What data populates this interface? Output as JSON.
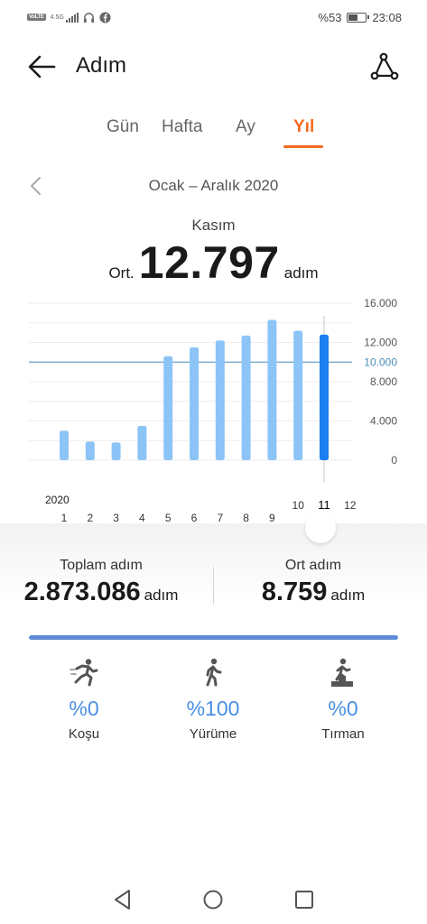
{
  "status_bar": {
    "volte": "VoLTE",
    "network": "4.5G",
    "battery_text": "%53",
    "battery_level": 0.53,
    "time": "23:08",
    "icons": [
      "headset-icon",
      "facebook-icon",
      "signal-icon",
      "battery-icon"
    ]
  },
  "app_bar": {
    "title": "Adım",
    "back_icon": "arrow-left-icon",
    "share_icon": "share-icon"
  },
  "tabs": [
    {
      "label": "Gün",
      "active": false
    },
    {
      "label": "Hafta",
      "active": false
    },
    {
      "label": "Ay",
      "active": false
    },
    {
      "label": "Yıl",
      "active": true
    }
  ],
  "period": {
    "label": "Ocak – Aralık 2020",
    "prev_icon": "chevron-left-icon"
  },
  "summary": {
    "month": "Kasım",
    "prefix": "Ort.",
    "value": "12.797",
    "unit": "adım"
  },
  "chart_data": {
    "type": "bar",
    "x": [
      1,
      2,
      3,
      4,
      5,
      6,
      7,
      8,
      9,
      10,
      11,
      12
    ],
    "tick_labels": [
      "1",
      "2",
      "3",
      "4",
      "5",
      "6",
      "7",
      "8",
      "9",
      "10",
      "11",
      "12"
    ],
    "year_label": "2020",
    "values": [
      3000,
      1900,
      1800,
      3500,
      10600,
      11500,
      12200,
      12700,
      14300,
      13200,
      12797,
      null
    ],
    "selected_index": 10,
    "y_ticks": [
      0,
      4000,
      8000,
      12000,
      16000
    ],
    "y_tick_labels": [
      "0",
      "4.000",
      "8.000",
      "12.000",
      "16.000"
    ],
    "goal_value": 10000,
    "goal_label": "10.000",
    "ylim": [
      0,
      16000
    ],
    "colors": {
      "bar": "#8cc4f7",
      "selected_bar": "#1a7ff0",
      "goal_line": "#4a8fb8"
    }
  },
  "stats": {
    "total": {
      "title": "Toplam adım",
      "value": "2.873.086",
      "unit": "adım"
    },
    "average": {
      "title": "Ort adım",
      "value": "8.759",
      "unit": "adım"
    }
  },
  "progress_level": 1.0,
  "activities": [
    {
      "icon": "running-icon",
      "pct": "%0",
      "label": "Koşu"
    },
    {
      "icon": "walking-icon",
      "pct": "%100",
      "label": "Yürüme"
    },
    {
      "icon": "climbing-icon",
      "pct": "%0",
      "label": "Tırman"
    }
  ],
  "nav": [
    {
      "icon": "back-triangle-icon"
    },
    {
      "icon": "home-circle-icon"
    },
    {
      "icon": "recents-square-icon"
    }
  ],
  "colors": {
    "accent": "#f26b21",
    "blue": "#4a8fe3"
  }
}
